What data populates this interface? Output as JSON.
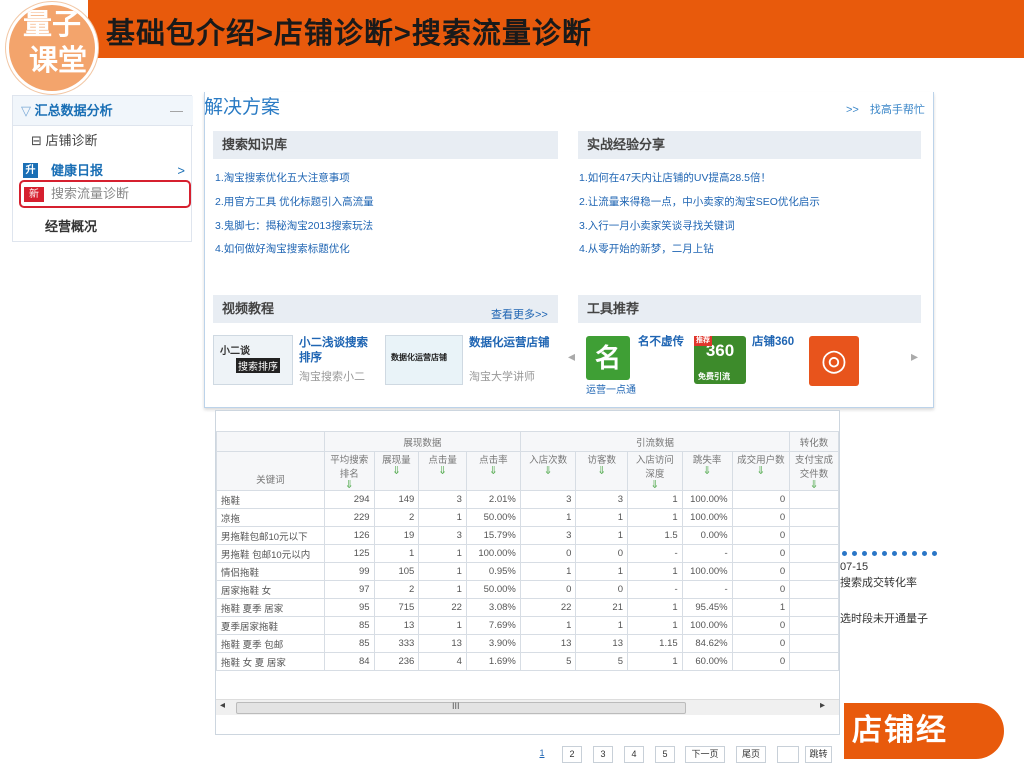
{
  "banner": {
    "title": "基础包介绍>店铺诊断>搜索流量诊断",
    "logo_line1": "量子",
    "logo_line2": "课堂"
  },
  "sidebar": {
    "header": "汇总数据分析",
    "header_toggle": "—",
    "shop_diagnosis": "⊟ 店铺诊断",
    "health_tag": "升",
    "health_daily": "健康日报",
    "health_arrow": ">",
    "new_tag": "新",
    "search_traffic": "搜索流量诊断",
    "overview": "经营概况"
  },
  "panel": {
    "title": "解决方案",
    "help_link": ">>　找高手帮忙",
    "search_kb": {
      "title": "搜索知识库",
      "links": [
        "1.淘宝搜索优化五大注意事项",
        "2.用官方工具 优化标题引入高流量",
        "3.鬼脚七：揭秘淘宝2013搜索玩法",
        "4.如何做好淘宝搜索标题优化"
      ]
    },
    "experience": {
      "title": "实战经验分享",
      "links": [
        "1.如何在47天内让店铺的UV提高28.5倍！",
        "2.让流量来得稳一点，中小卖家的淘宝SEO优化启示",
        "3.入行一月小卖家笑谈寻找关键词",
        "4.从零开始的新梦，二月上钻"
      ]
    },
    "video": {
      "title": "视频教程",
      "more": "查看更多>>",
      "items": [
        {
          "title": "小二浅谈搜索排序",
          "source": "淘宝搜索小二",
          "thumb_text": "搜索排序",
          "thumb_small": "小二谈"
        },
        {
          "title": "数据化运营店铺",
          "source": "淘宝大学讲师",
          "thumb_text": "数据化运营店铺"
        }
      ]
    },
    "tools": {
      "title": "工具推荐",
      "items": [
        {
          "title": "名不虚传",
          "icon_text": "名",
          "sub": "运营一点通"
        },
        {
          "title": "店铺360",
          "icon_text": "360",
          "sub": "免费引流",
          "badge": "推荐"
        },
        {
          "title": "",
          "icon_text": "◎"
        }
      ],
      "prev": "◂",
      "next": "▸"
    }
  },
  "table": {
    "groups": [
      "展现数据",
      "引流数据",
      "转化数"
    ],
    "columns": [
      "关键词",
      "平均搜索排名",
      "展现量",
      "点击量",
      "点击率",
      "入店次数",
      "访客数",
      "入店访问深度",
      "跳失率",
      "成交用户数",
      "支付宝成交件数"
    ],
    "sort_arrow": "⇓",
    "rows": [
      [
        "拖鞋",
        "294",
        "149",
        "3",
        "2.01%",
        "3",
        "3",
        "1",
        "100.00%",
        "0"
      ],
      [
        "凉拖",
        "229",
        "2",
        "1",
        "50.00%",
        "1",
        "1",
        "1",
        "100.00%",
        "0"
      ],
      [
        "男拖鞋包邮10元以下",
        "126",
        "19",
        "3",
        "15.79%",
        "3",
        "1",
        "1.5",
        "0.00%",
        "0"
      ],
      [
        "男拖鞋 包邮10元以内",
        "125",
        "1",
        "1",
        "100.00%",
        "0",
        "0",
        "-",
        "-",
        "0"
      ],
      [
        "情侣拖鞋",
        "99",
        "105",
        "1",
        "0.95%",
        "1",
        "1",
        "1",
        "100.00%",
        "0"
      ],
      [
        "居家拖鞋 女",
        "97",
        "2",
        "1",
        "50.00%",
        "0",
        "0",
        "-",
        "-",
        "0"
      ],
      [
        "拖鞋 夏季 居家",
        "95",
        "715",
        "22",
        "3.08%",
        "22",
        "21",
        "1",
        "95.45%",
        "1"
      ],
      [
        "夏季居家拖鞋",
        "85",
        "13",
        "1",
        "7.69%",
        "1",
        "1",
        "1",
        "100.00%",
        "0"
      ],
      [
        "拖鞋 夏季 包邮",
        "85",
        "333",
        "13",
        "3.90%",
        "13",
        "13",
        "1.15",
        "84.62%",
        "0"
      ],
      [
        "拖鞋 女 夏 居家",
        "84",
        "236",
        "4",
        "1.69%",
        "5",
        "5",
        "1",
        "60.00%",
        "0"
      ]
    ],
    "scroll_left": "◂",
    "scroll_mid": "III",
    "scroll_right": "▸"
  },
  "pager": {
    "pages": [
      "1",
      "2",
      "3",
      "4",
      "5"
    ],
    "next": "下一页",
    "last": "尾页",
    "jump": "跳转"
  },
  "background": {
    "date": "07-15",
    "chart_title": "搜索成交转化率",
    "note": "选时段未开通量子"
  },
  "store_button": "店铺经",
  "colors": {
    "banner": "#e85a0c",
    "link": "#1f65b3",
    "highlight": "#d6202f"
  }
}
